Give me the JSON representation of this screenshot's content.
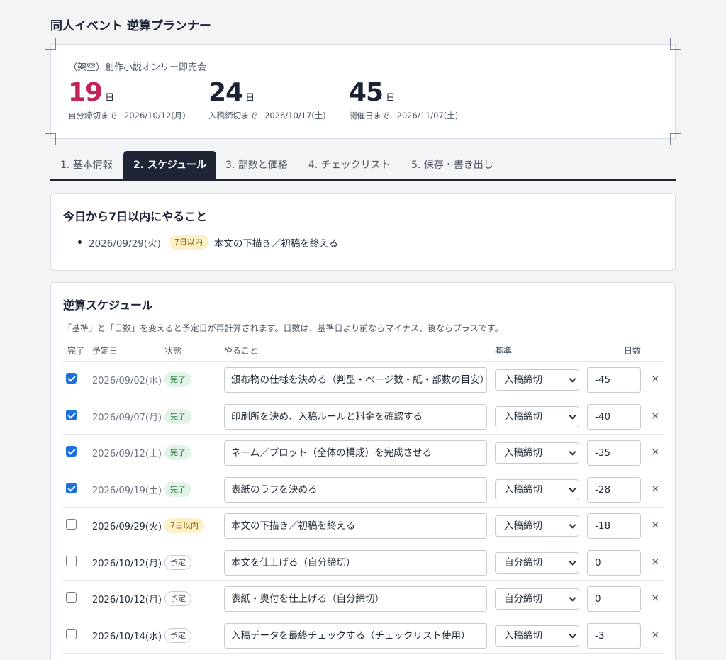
{
  "app_title": "同人イベント 逆算プランナー",
  "event_name": "（架空）創作小説オンリー即売会",
  "countdowns": [
    {
      "number": "19",
      "unit": "日",
      "label": "自分締切まで",
      "date": "2026/10/12(月)",
      "accent": true
    },
    {
      "number": "24",
      "unit": "日",
      "label": "入稿締切まで",
      "date": "2026/10/17(土)",
      "accent": false
    },
    {
      "number": "45",
      "unit": "日",
      "label": "開催日まで",
      "date": "2026/11/07(土)",
      "accent": false
    }
  ],
  "tabs": [
    {
      "label": "1. 基本情報",
      "active": false
    },
    {
      "label": "2. スケジュール",
      "active": true
    },
    {
      "label": "3. 部数と価格",
      "active": false
    },
    {
      "label": "4. チェックリスト",
      "active": false
    },
    {
      "label": "5. 保存・書き出し",
      "active": false
    }
  ],
  "upcoming": {
    "title": "今日から7日以内にやること",
    "items": [
      {
        "date": "2026/09/29(火)",
        "badge": "7日以内",
        "task": "本文の下描き／初稿を終える"
      }
    ]
  },
  "schedule": {
    "title": "逆算スケジュール",
    "note": "「基準」と「日数」を変えると予定日が再計算されます。日数は、基準日より前ならマイナス、後ならプラスです。",
    "headers": {
      "done": "完了",
      "date": "予定日",
      "status": "状態",
      "task": "やること",
      "basis": "基準",
      "days": "日数"
    },
    "delete_glyph": "×",
    "rows": [
      {
        "done": true,
        "date": "2026/09/02(水)",
        "status": "完了",
        "status_type": "done",
        "task": "頒布物の仕様を決める（判型・ページ数・紙・部数の目安）",
        "basis": "入稿締切",
        "days": "-45"
      },
      {
        "done": true,
        "date": "2026/09/07(月)",
        "status": "完了",
        "status_type": "done",
        "task": "印刷所を決め、入稿ルールと料金を確認する",
        "basis": "入稿締切",
        "days": "-40"
      },
      {
        "done": true,
        "date": "2026/09/12(土)",
        "status": "完了",
        "status_type": "done",
        "task": "ネーム／プロット（全体の構成）を完成させる",
        "basis": "入稿締切",
        "days": "-35"
      },
      {
        "done": true,
        "date": "2026/09/19(土)",
        "status": "完了",
        "status_type": "done",
        "task": "表紙のラフを決める",
        "basis": "入稿締切",
        "days": "-28"
      },
      {
        "done": false,
        "date": "2026/09/29(火)",
        "status": "7日以内",
        "status_type": "soon",
        "task": "本文の下描き／初稿を終える",
        "basis": "入稿締切",
        "days": "-18"
      },
      {
        "done": false,
        "date": "2026/10/12(月)",
        "status": "予定",
        "status_type": "plan",
        "task": "本文を仕上げる（自分締切）",
        "basis": "自分締切",
        "days": "0"
      },
      {
        "done": false,
        "date": "2026/10/12(月)",
        "status": "予定",
        "status_type": "plan",
        "task": "表紙・奥付を仕上げる（自分締切）",
        "basis": "自分締切",
        "days": "0"
      },
      {
        "done": false,
        "date": "2026/10/14(水)",
        "status": "予定",
        "status_type": "plan",
        "task": "入稿データを最終チェックする（チェックリスト使用）",
        "basis": "入稿締切",
        "days": "-3"
      }
    ]
  }
}
